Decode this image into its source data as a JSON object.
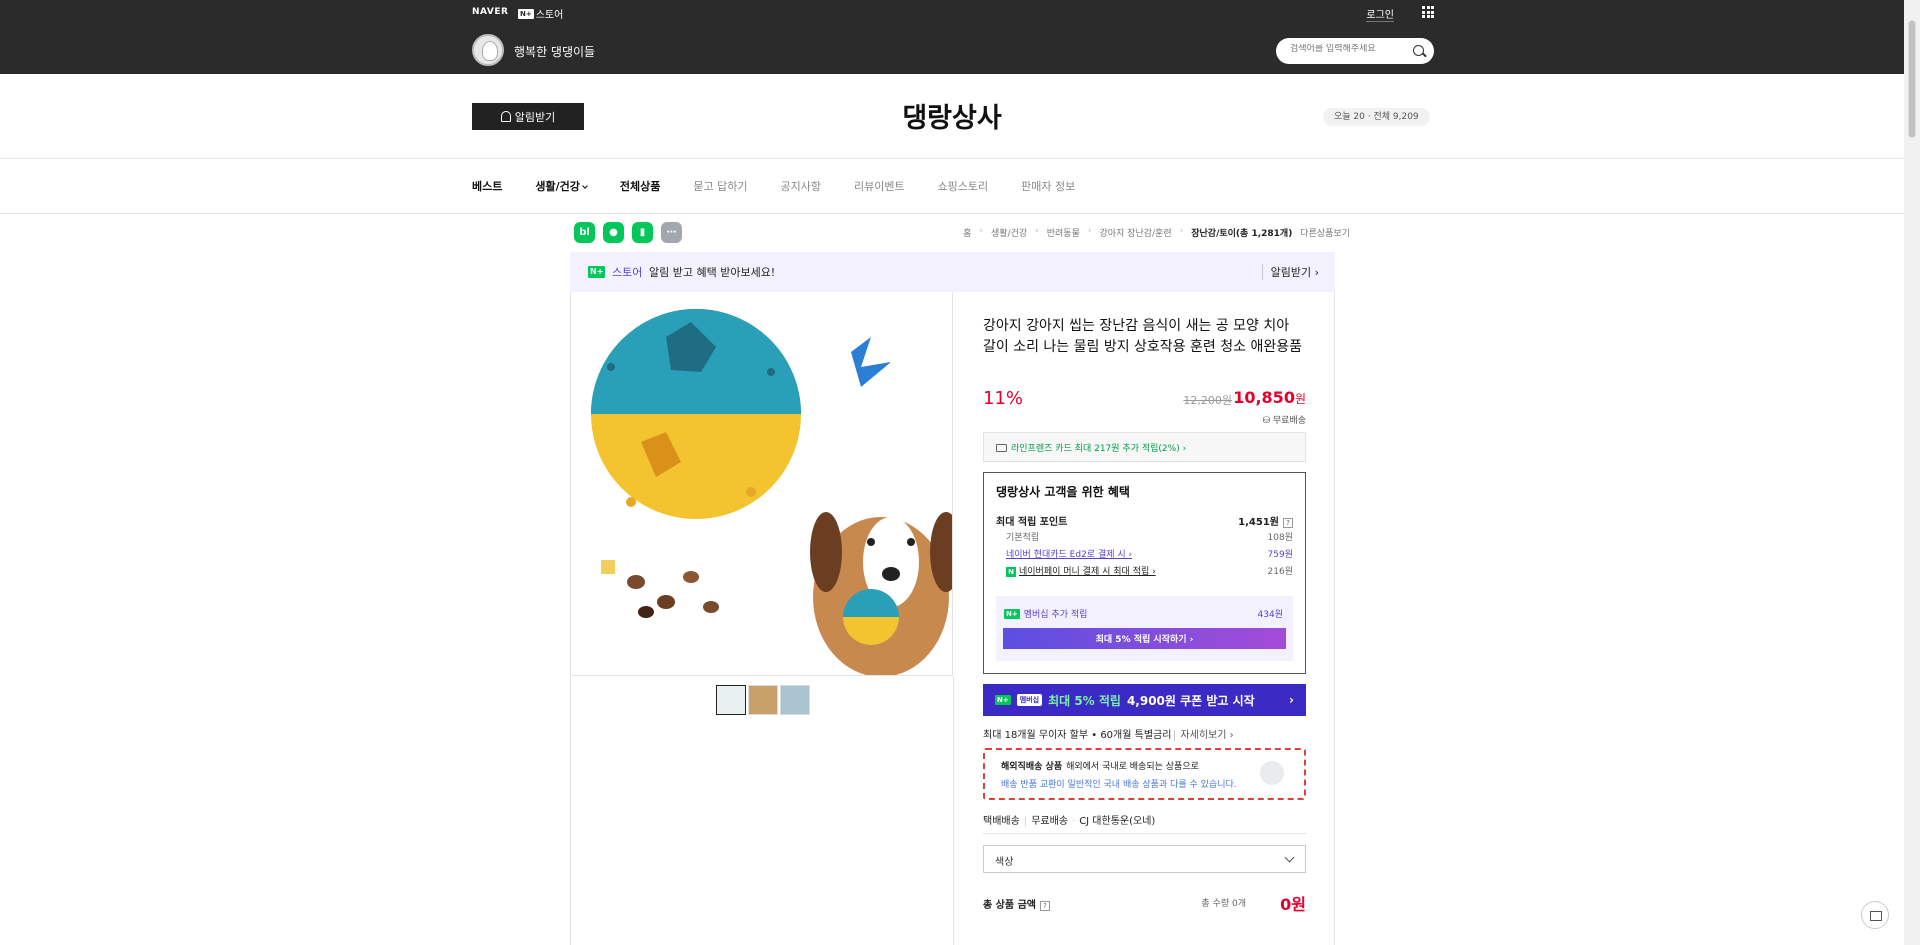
{
  "topbar": {
    "naver": "NAVER",
    "store_badge": "N+",
    "store_label": "스토어",
    "login": "로그인",
    "store_name": "행복한 댕댕이들",
    "search_placeholder": "검색어를 입력해주세요"
  },
  "header": {
    "alarm_button": "알림받기",
    "store_title": "댕랑상사",
    "visit_count": "오늘 20 · 전체 9,209"
  },
  "nav": [
    "베스트",
    "생활/건강",
    "전체상품",
    "묻고 답하기",
    "공지사항",
    "리뷰이벤트",
    "쇼핑스토리",
    "판매자 정보"
  ],
  "util_icons": [
    "bl",
    "talk-icon",
    "bookmark-icon",
    "more-icon"
  ],
  "breadcrumb": [
    "홈",
    "생활/건강",
    "반려동물",
    "강아지 장난감/훈련",
    "장난감/토이(총 1,281개)",
    "다른상품보기"
  ],
  "alert_strip": {
    "badge": "N+",
    "store": "스토어",
    "text": "알림 받고 혜택 받아보세요!",
    "link": "알림받기 ›"
  },
  "product": {
    "title": "강아지 강아지 씹는 장난감 음식이 새는 공 모양 치아 갈이 소리 나는 물림 방지 상호작용 훈련 청소 애완용품",
    "discount": "11%",
    "orig_price": "12,200원",
    "sale_price": "10,850",
    "sale_unit": "원",
    "free_ship": "무료배송",
    "card_benefit": "라인프렌즈 카드 최대 217원 추가 적립(2%) ›",
    "benefit_title": "댕랑상사 고객을 위한 혜택",
    "max_point_label": "최대 적립 포인트",
    "max_point_value": "1,451원",
    "basic_label": "기본적립",
    "basic_value": "108원",
    "hyundai_label": "네이버 현대카드 Ed2로 결제 시 ›",
    "hyundai_value": "759원",
    "npay_label": "네이버페이 머니 결제 시 최대 적립 ›",
    "npay_value": "216원",
    "member_label": "멤버십 추가 적립",
    "member_value": "434원",
    "member_button": "최대 5% 적립 시작하기 ›",
    "promo_tag": "멤버십",
    "promo_hl": "최대 5% 적립",
    "promo_text": "4,900원 쿠폰 받고 시작",
    "installment": "최대 18개월 무이자 할부 • 60개월 특별금리",
    "installment_link": "자세히보기 ›",
    "overseas_title": "해외직배송 상품",
    "overseas_desc": "해외에서 국내로 배송되는 상품으로",
    "overseas_note": "배송 반품 교환이 일반적인 국내 배송 상품과 다를 수 있습니다.",
    "ship_type": "택배배송",
    "ship_cost": "무료배송",
    "ship_company": "CJ 대한통운(오네)",
    "option_label": "색상",
    "total_label": "총 상품 금액",
    "total_count": "총 수량 0개",
    "total_price": "0원"
  }
}
